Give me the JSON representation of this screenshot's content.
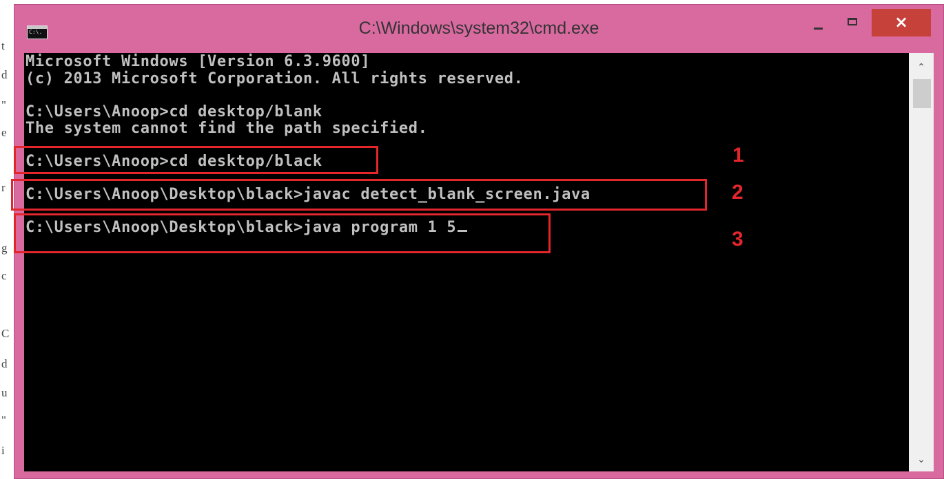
{
  "window": {
    "title": "C:\\Windows\\system32\\cmd.exe",
    "icon": "cmd-icon",
    "icon_text": "C:\\.",
    "controls": {
      "minimize": "minimize-icon",
      "maximize": "maximize-icon",
      "close": "×"
    }
  },
  "console": {
    "lines": [
      "Microsoft Windows [Version 6.3.9600]",
      "(c) 2013 Microsoft Corporation. All rights reserved.",
      "",
      "C:\\Users\\Anoop>cd desktop/blank",
      "The system cannot find the path specified.",
      "",
      "C:\\Users\\Anoop>cd desktop/black",
      "",
      "C:\\Users\\Anoop\\Desktop\\black>javac detect_blank_screen.java",
      "",
      "C:\\Users\\Anoop\\Desktop\\black>java program 1 5"
    ],
    "text_color": "#c0c0c0",
    "background": "#000000"
  },
  "annotations": [
    {
      "label": "1",
      "color": "#e3262b"
    },
    {
      "label": "2",
      "color": "#e3262b"
    },
    {
      "label": "3",
      "color": "#e3262b"
    }
  ],
  "background_fragments": [
    "t",
    "d",
    "\"",
    "e",
    "r",
    "g",
    "c",
    "C",
    "d",
    "u",
    "\"",
    "i"
  ],
  "colors": {
    "titlebar": "#d96aa0",
    "close_button": "#c7413b",
    "highlight": "#e3262b"
  },
  "scrollbar": {
    "up": "up-arrow-icon",
    "down": "down-arrow-icon"
  }
}
